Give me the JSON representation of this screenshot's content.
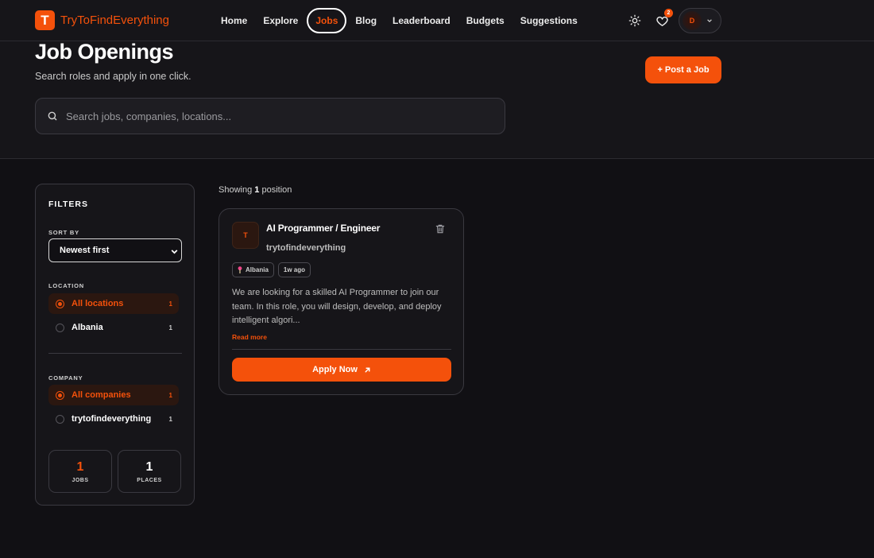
{
  "brand": {
    "logo_letter": "T",
    "name": "TryToFindEverything"
  },
  "nav": {
    "links": [
      "Home",
      "Explore",
      "Jobs",
      "Blog",
      "Leaderboard",
      "Budgets",
      "Suggestions"
    ],
    "active": "Jobs",
    "favorites_count": "2",
    "user_initial": "D"
  },
  "hero": {
    "title": "Job Openings",
    "subtitle": "Search roles and apply in one click.",
    "post_button": "+ Post a Job",
    "search_placeholder": "Search jobs, companies, locations..."
  },
  "filters": {
    "title": "FILTERS",
    "sort_label": "SORT BY",
    "sort_value": "Newest first",
    "location_label": "LOCATION",
    "locations": [
      {
        "label": "All locations",
        "count": "1",
        "selected": true
      },
      {
        "label": "Albania",
        "count": "1",
        "selected": false
      }
    ],
    "company_label": "COMPANY",
    "companies": [
      {
        "label": "All companies",
        "count": "1",
        "selected": true
      },
      {
        "label": "trytofindeverything",
        "count": "1",
        "selected": false
      }
    ],
    "stats": [
      {
        "value": "1",
        "label": "JOBS"
      },
      {
        "value": "1",
        "label": "PLACES"
      }
    ]
  },
  "results": {
    "showing_prefix": "Showing",
    "showing_count": "1",
    "showing_suffix": "position"
  },
  "job": {
    "logo_letter": "T",
    "title": "AI Programmer / Engineer",
    "company": "trytofindeverything",
    "location": "Albania",
    "posted": "1w ago",
    "description": "We are looking for a skilled AI Programmer to join our team. In this role, you will design, develop, and deploy intelligent algori...",
    "read_more": "Read more",
    "apply_label": "Apply Now"
  },
  "colors": {
    "accent": "#f4510b",
    "background": "#111014",
    "surface": "#161519"
  }
}
